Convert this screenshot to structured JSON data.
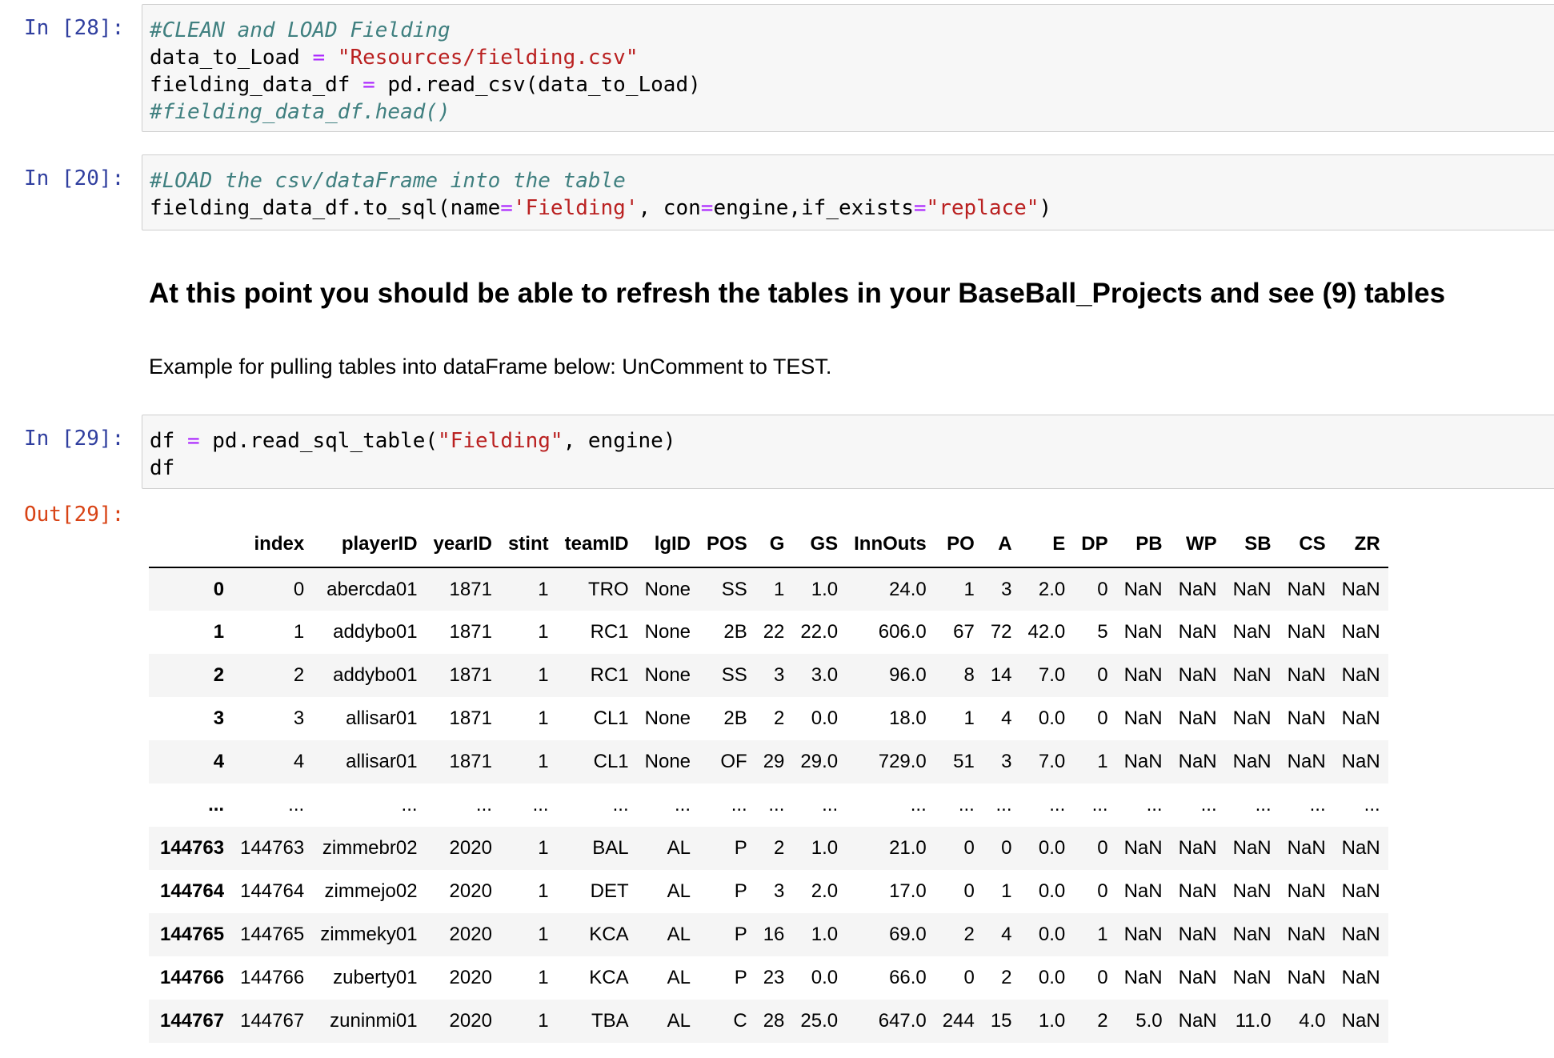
{
  "cells": {
    "c28": {
      "prompt": "In [28]:",
      "lines": [
        [
          {
            "t": "#CLEAN and LOAD Fielding",
            "c": "cm"
          }
        ],
        [
          {
            "t": "data_to_Load "
          },
          {
            "t": "=",
            "c": "op"
          },
          {
            "t": " "
          },
          {
            "t": "\"Resources/fielding.csv\"",
            "c": "st"
          }
        ],
        [
          {
            "t": "fielding_data_df "
          },
          {
            "t": "=",
            "c": "op"
          },
          {
            "t": " pd.read_csv(data_to_Load)"
          }
        ],
        [
          {
            "t": "#fielding_data_df.head()",
            "c": "cm"
          }
        ]
      ]
    },
    "c20": {
      "prompt": "In [20]:",
      "lines": [
        [
          {
            "t": "#LOAD the csv/dataFrame into the table",
            "c": "cm"
          }
        ],
        [
          {
            "t": "fielding_data_df.to_sql(name"
          },
          {
            "t": "=",
            "c": "op"
          },
          {
            "t": "'Fielding'",
            "c": "st"
          },
          {
            "t": ", con"
          },
          {
            "t": "=",
            "c": "op"
          },
          {
            "t": "engine,if_exists"
          },
          {
            "t": "=",
            "c": "op"
          },
          {
            "t": "\"replace\"",
            "c": "st"
          },
          {
            "t": ")"
          }
        ]
      ]
    },
    "c29": {
      "prompt": "In [29]:",
      "lines": [
        [
          {
            "t": "df "
          },
          {
            "t": "=",
            "c": "op"
          },
          {
            "t": " pd.read_sql_table("
          },
          {
            "t": "\"Fielding\"",
            "c": "st"
          },
          {
            "t": ", engine)"
          }
        ],
        [
          {
            "t": "df"
          }
        ]
      ]
    }
  },
  "markdown": {
    "heading": "At this point you should be able to refresh the tables in your BaseBall_Projects and see (9) tables",
    "text": "Example for pulling tables into dataFrame below: UnComment to TEST."
  },
  "output": {
    "prompt": "Out[29]:",
    "columns": [
      "",
      "index",
      "playerID",
      "yearID",
      "stint",
      "teamID",
      "lgID",
      "POS",
      "G",
      "GS",
      "InnOuts",
      "PO",
      "A",
      "E",
      "DP",
      "PB",
      "WP",
      "SB",
      "CS",
      "ZR"
    ],
    "rows": [
      [
        "0",
        "0",
        "abercda01",
        "1871",
        "1",
        "TRO",
        "None",
        "SS",
        "1",
        "1.0",
        "24.0",
        "1",
        "3",
        "2.0",
        "0",
        "NaN",
        "NaN",
        "NaN",
        "NaN",
        "NaN"
      ],
      [
        "1",
        "1",
        "addybo01",
        "1871",
        "1",
        "RC1",
        "None",
        "2B",
        "22",
        "22.0",
        "606.0",
        "67",
        "72",
        "42.0",
        "5",
        "NaN",
        "NaN",
        "NaN",
        "NaN",
        "NaN"
      ],
      [
        "2",
        "2",
        "addybo01",
        "1871",
        "1",
        "RC1",
        "None",
        "SS",
        "3",
        "3.0",
        "96.0",
        "8",
        "14",
        "7.0",
        "0",
        "NaN",
        "NaN",
        "NaN",
        "NaN",
        "NaN"
      ],
      [
        "3",
        "3",
        "allisar01",
        "1871",
        "1",
        "CL1",
        "None",
        "2B",
        "2",
        "0.0",
        "18.0",
        "1",
        "4",
        "0.0",
        "0",
        "NaN",
        "NaN",
        "NaN",
        "NaN",
        "NaN"
      ],
      [
        "4",
        "4",
        "allisar01",
        "1871",
        "1",
        "CL1",
        "None",
        "OF",
        "29",
        "29.0",
        "729.0",
        "51",
        "3",
        "7.0",
        "1",
        "NaN",
        "NaN",
        "NaN",
        "NaN",
        "NaN"
      ],
      [
        "...",
        "...",
        "...",
        "...",
        "...",
        "...",
        "...",
        "...",
        "...",
        "...",
        "...",
        "...",
        "...",
        "...",
        "...",
        "...",
        "...",
        "...",
        "...",
        "..."
      ],
      [
        "144763",
        "144763",
        "zimmebr02",
        "2020",
        "1",
        "BAL",
        "AL",
        "P",
        "2",
        "1.0",
        "21.0",
        "0",
        "0",
        "0.0",
        "0",
        "NaN",
        "NaN",
        "NaN",
        "NaN",
        "NaN"
      ],
      [
        "144764",
        "144764",
        "zimmejo02",
        "2020",
        "1",
        "DET",
        "AL",
        "P",
        "3",
        "2.0",
        "17.0",
        "0",
        "1",
        "0.0",
        "0",
        "NaN",
        "NaN",
        "NaN",
        "NaN",
        "NaN"
      ],
      [
        "144765",
        "144765",
        "zimmeky01",
        "2020",
        "1",
        "KCA",
        "AL",
        "P",
        "16",
        "1.0",
        "69.0",
        "2",
        "4",
        "0.0",
        "1",
        "NaN",
        "NaN",
        "NaN",
        "NaN",
        "NaN"
      ],
      [
        "144766",
        "144766",
        "zuberty01",
        "2020",
        "1",
        "KCA",
        "AL",
        "P",
        "23",
        "0.0",
        "66.0",
        "0",
        "2",
        "0.0",
        "0",
        "NaN",
        "NaN",
        "NaN",
        "NaN",
        "NaN"
      ],
      [
        "144767",
        "144767",
        "zuninmi01",
        "2020",
        "1",
        "TBA",
        "AL",
        "C",
        "28",
        "25.0",
        "647.0",
        "244",
        "15",
        "1.0",
        "2",
        "5.0",
        "NaN",
        "11.0",
        "4.0",
        "NaN"
      ]
    ]
  }
}
